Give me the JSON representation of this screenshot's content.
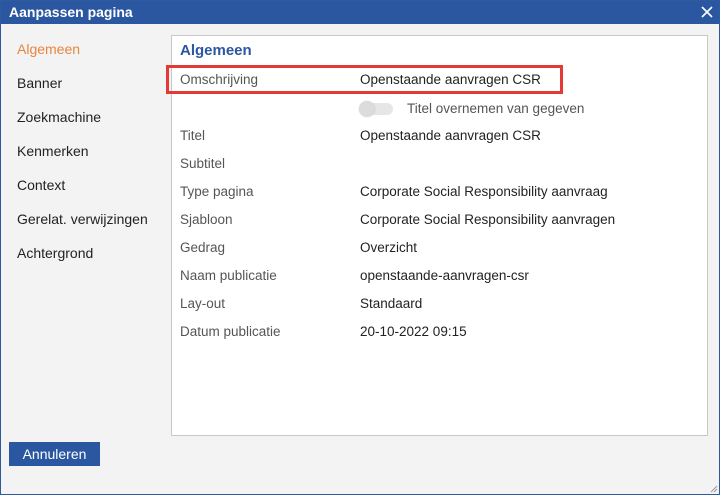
{
  "dialog": {
    "title": "Aanpassen pagina",
    "close_icon": "close-icon"
  },
  "nav": {
    "items": [
      {
        "label": "Algemeen",
        "active": true
      },
      {
        "label": "Banner"
      },
      {
        "label": "Zoekmachine"
      },
      {
        "label": "Kenmerken"
      },
      {
        "label": "Context"
      },
      {
        "label": "Gerelat. verwijzingen"
      },
      {
        "label": "Achtergrond"
      }
    ]
  },
  "panel": {
    "title": "Algemeen",
    "fields": [
      {
        "label": "Omschrijving",
        "value": "Openstaande aanvragen CSR"
      },
      {
        "label": "Titel",
        "value": "Openstaande aanvragen CSR"
      },
      {
        "label": "Subtitel",
        "value": ""
      },
      {
        "label": "Type pagina",
        "value": "Corporate Social Responsibility aanvraag"
      },
      {
        "label": "Sjabloon",
        "value": "Corporate Social Responsibility aanvragen"
      },
      {
        "label": "Gedrag",
        "value": "Overzicht"
      },
      {
        "label": "Naam publicatie",
        "value": "openstaande-aanvragen-csr"
      },
      {
        "label": "Lay-out",
        "value": "Standaard"
      },
      {
        "label": "Datum publicatie",
        "value": "20-10-2022 09:15"
      }
    ],
    "toggle": {
      "label": "Titel overnemen van gegeven",
      "on": false
    }
  },
  "footer": {
    "cancel_label": "Annuleren"
  },
  "colors": {
    "accent": "#2b57a0",
    "active_nav": "#e8853d",
    "highlight": "#e53935"
  }
}
